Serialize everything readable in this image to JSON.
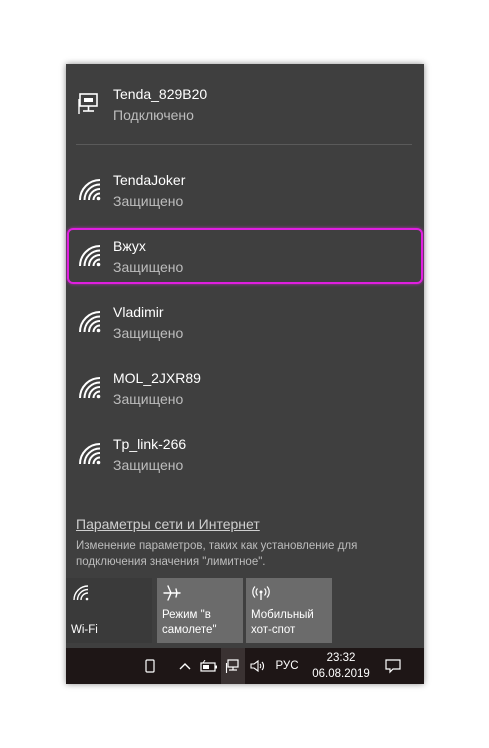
{
  "connected": {
    "ssid": "Tenda_829B20",
    "status": "Подключено",
    "icon": "ethernet-icon"
  },
  "networks": [
    {
      "ssid": "TendaJoker",
      "status": "Защищено",
      "icon": "wifi-icon"
    },
    {
      "ssid": "Вжух",
      "status": "Защищено",
      "icon": "wifi-icon",
      "highlighted": true
    },
    {
      "ssid": "Vladimir",
      "status": "Защищено",
      "icon": "wifi-icon"
    },
    {
      "ssid": "MOL_2JXR89",
      "status": "Защищено",
      "icon": "wifi-icon"
    },
    {
      "ssid": "Tp_link-266",
      "status": "Защищено",
      "icon": "wifi-icon"
    }
  ],
  "settings": {
    "link": "Параметры сети и Интернет",
    "description": "Изменение параметров, таких как установление для подключения значения \"лимитное\"."
  },
  "quick_actions": [
    {
      "label": "Wi-Fi",
      "icon": "wifi-icon",
      "state": "off"
    },
    {
      "label": "Режим \"в\nсамолете\"",
      "icon": "airplane-icon",
      "state": "off"
    },
    {
      "label": "Мобильный\nхот-спот",
      "icon": "hotspot-icon",
      "state": "off"
    }
  ],
  "taskbar": {
    "language": "РУС",
    "time": "23:32",
    "date": "06.08.2019"
  },
  "colors": {
    "flyout_bg": "#3f3f3f",
    "highlight": "#e01fe0",
    "taskbar_bg": "#1e1616"
  }
}
